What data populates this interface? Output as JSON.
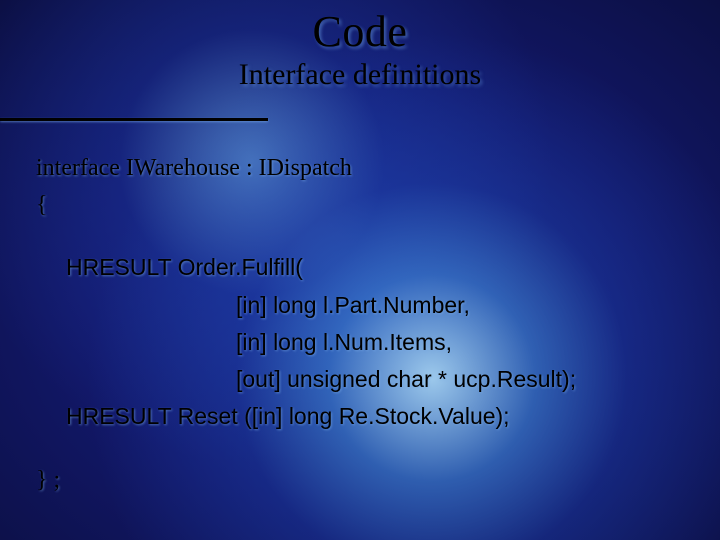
{
  "title": "Code",
  "subtitle": "Interface definitions",
  "lines": {
    "l1": "interface IWarehouse :  IDispatch",
    "l2": "{",
    "l3": "HRESULT Order.Fulfill(",
    "l4": "[in] long l.Part.Number,",
    "l5": "[in] long l.Num.Items,",
    "l6": "[out] unsigned char * ucp.Result);",
    "l7": "HRESULT Reset ([in] long Re.Stock.Value);",
    "l8": "} ;"
  }
}
